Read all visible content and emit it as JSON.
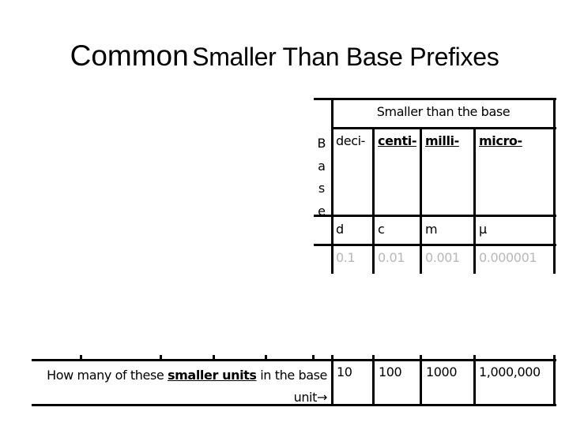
{
  "slide": {
    "title_main": "Common",
    "title_rest": "Smaller Than Base Prefixes"
  },
  "table": {
    "group_header": "Smaller than the base",
    "base_label_letters": [
      "B",
      "a",
      "s",
      "e"
    ],
    "prefixes": [
      {
        "name": "deci-",
        "symbol": "d",
        "value": "0.1",
        "count": "10",
        "emphasized": false
      },
      {
        "name": "centi-",
        "symbol": "c",
        "value": "0.01",
        "count": "100",
        "emphasized": true
      },
      {
        "name": "milli-",
        "symbol": "m",
        "value": "0.001",
        "count": "1000",
        "emphasized": true
      },
      {
        "name": "micro-",
        "symbol": "µ",
        "value": "0.000001",
        "count": "1,000,000",
        "emphasized": true
      }
    ],
    "count_row_label": {
      "before": "How many of these ",
      "emphasis": "smaller units",
      "after": " in the base",
      "line2": "unit",
      "arrow": "→"
    }
  },
  "colors": {
    "value_text": "#b8b8b8",
    "line": "#000000"
  }
}
